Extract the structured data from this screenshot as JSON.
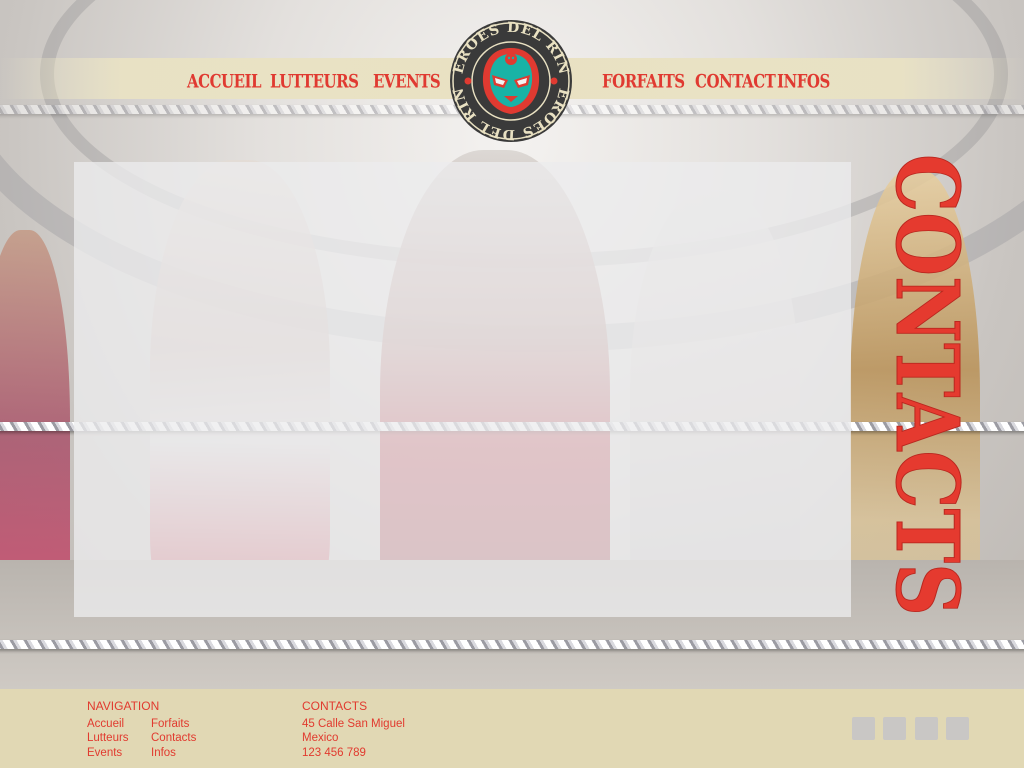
{
  "brand": {
    "logo_text": "HEROES DEL RING",
    "colors": {
      "accent": "#e03a31",
      "footer_bg": "#e1d8b4",
      "logo_mask": "#19b3a6"
    }
  },
  "nav": {
    "left": [
      "ACCUEIL",
      "LUTTEURS",
      "EVENTS"
    ],
    "right": [
      "FORFAITS",
      "CONTACT",
      "INFOS"
    ]
  },
  "page": {
    "title": "CONTACTS"
  },
  "footer": {
    "navigation": {
      "heading": "NAVIGATION",
      "col1": [
        "Accueil",
        "Lutteurs",
        "Events"
      ],
      "col2": [
        "Forfaits",
        "Contacts",
        "Infos"
      ]
    },
    "contacts": {
      "heading": "CONTACTS",
      "address": "45 Calle San Miguel",
      "country": "Mexico",
      "phone": "123 456 789"
    },
    "social_icons": [
      "social-icon-1",
      "social-icon-2",
      "social-icon-3",
      "social-icon-4"
    ]
  }
}
